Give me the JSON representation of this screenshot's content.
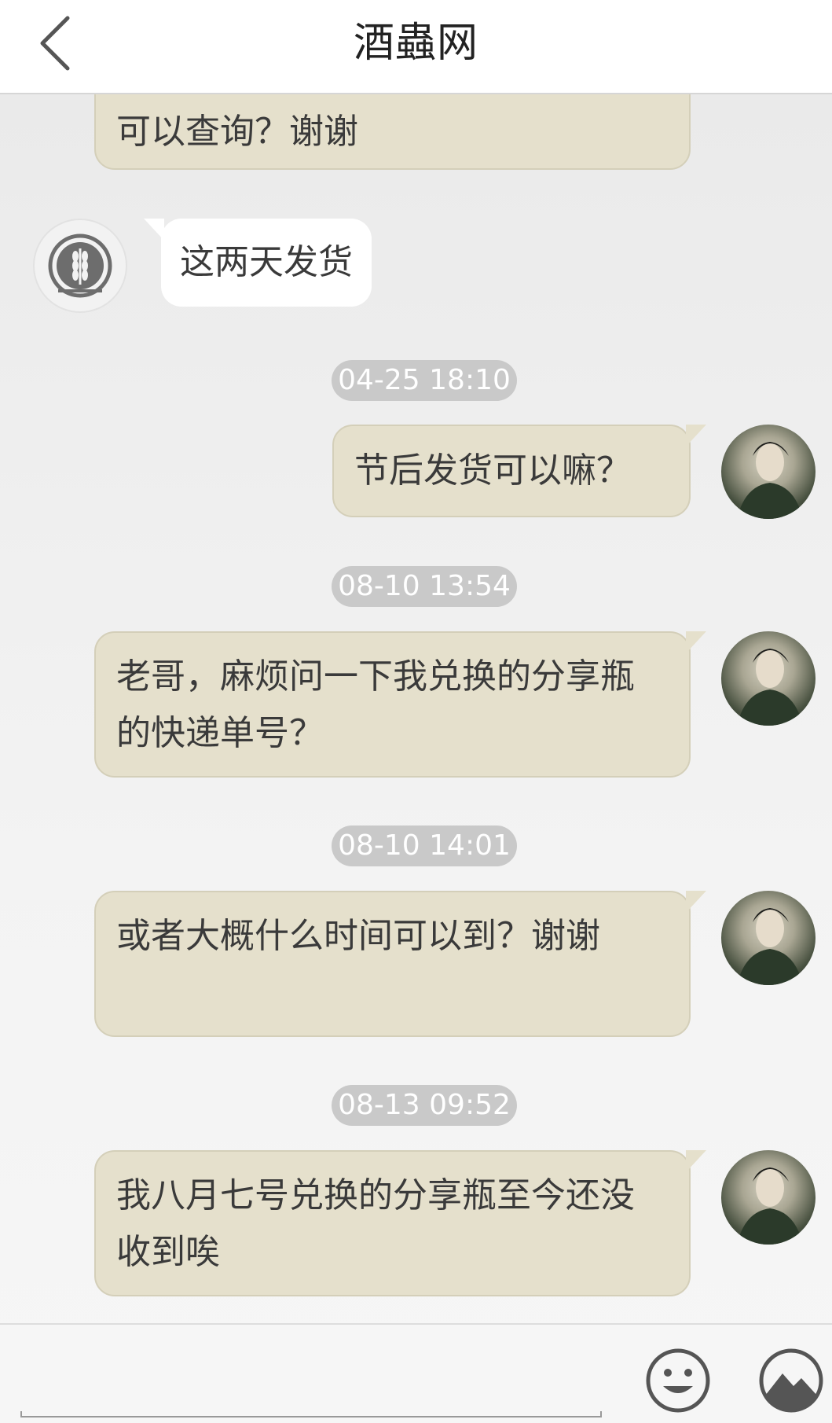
{
  "header": {
    "title": "酒蟲网",
    "back_icon": "chevron-left-icon"
  },
  "messages": [
    {
      "sender": "user",
      "text": "可以查询？谢谢"
    },
    {
      "sender": "shop",
      "text": "这两天发货"
    },
    {
      "timestamp": "04-25 18:10"
    },
    {
      "sender": "user",
      "text": "节后发货可以嘛？"
    },
    {
      "timestamp": "08-10 13:54"
    },
    {
      "sender": "user",
      "text": "老哥，麻烦问一下我兑换的分享瓶的快递单号？"
    },
    {
      "timestamp": "08-10 14:01"
    },
    {
      "sender": "user",
      "text": "或者大概什么时间可以到？谢谢"
    },
    {
      "timestamp": "08-13 09:52"
    },
    {
      "sender": "user",
      "text": "我八月七号兑换的分享瓶至今还没收到唉"
    }
  ],
  "footer": {
    "input_value": "",
    "emoji_icon": "smiley-icon",
    "image_icon": "image-icon"
  },
  "colors": {
    "user_bubble": "#e5e0cc",
    "shop_bubble": "#ffffff",
    "timestamp_bg": "#c9c9c9",
    "header_bg": "#ffffff"
  }
}
